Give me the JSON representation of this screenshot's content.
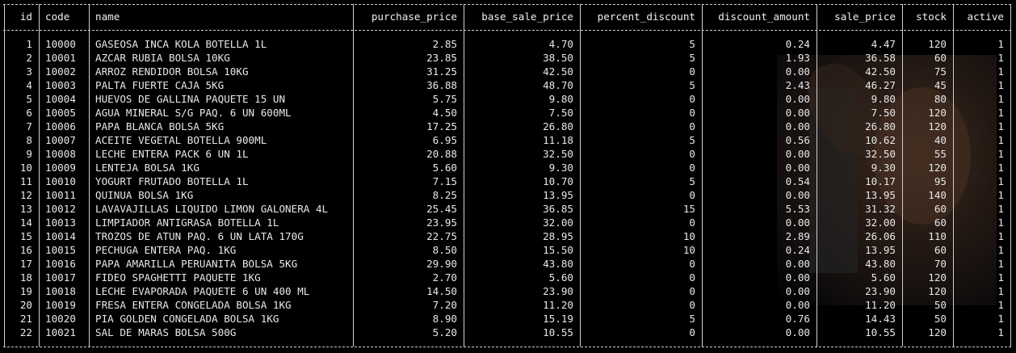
{
  "table": {
    "columns": [
      {
        "key": "id",
        "label": "id",
        "align": "r"
      },
      {
        "key": "code",
        "label": "code",
        "align": "l"
      },
      {
        "key": "name",
        "label": "name",
        "align": "l"
      },
      {
        "key": "purchase_price",
        "label": "purchase_price",
        "align": "r"
      },
      {
        "key": "base_sale_price",
        "label": "base_sale_price",
        "align": "r"
      },
      {
        "key": "percent_discount",
        "label": "percent_discount",
        "align": "r"
      },
      {
        "key": "discount_amount",
        "label": "discount_amount",
        "align": "r"
      },
      {
        "key": "sale_price",
        "label": "sale_price",
        "align": "r"
      },
      {
        "key": "stock",
        "label": "stock",
        "align": "r"
      },
      {
        "key": "active",
        "label": "active",
        "align": "r"
      }
    ],
    "rows": [
      [
        "1",
        "10000",
        "GASEOSA INCA KOLA BOTELLA 1L",
        "2.85",
        "4.70",
        "5",
        "0.24",
        "4.47",
        "120",
        "1"
      ],
      [
        "2",
        "10001",
        "AZCAR RUBIA BOLSA 10KG",
        "23.85",
        "38.50",
        "5",
        "1.93",
        "36.58",
        "60",
        "1"
      ],
      [
        "3",
        "10002",
        "ARROZ RENDIDOR BOLSA 10KG",
        "31.25",
        "42.50",
        "0",
        "0.00",
        "42.50",
        "75",
        "1"
      ],
      [
        "4",
        "10003",
        "PALTA FUERTE CAJA 5KG",
        "36.88",
        "48.70",
        "5",
        "2.43",
        "46.27",
        "45",
        "1"
      ],
      [
        "5",
        "10004",
        "HUEVOS DE GALLINA PAQUETE 15 UN",
        "5.75",
        "9.80",
        "0",
        "0.00",
        "9.80",
        "80",
        "1"
      ],
      [
        "6",
        "10005",
        "AGUA MINERAL S/G PAQ. 6 UN 600ML",
        "4.50",
        "7.50",
        "0",
        "0.00",
        "7.50",
        "120",
        "1"
      ],
      [
        "7",
        "10006",
        "PAPA BLANCA BOLSA 5KG",
        "17.25",
        "26.80",
        "0",
        "0.00",
        "26.80",
        "120",
        "1"
      ],
      [
        "8",
        "10007",
        "ACEITE VEGETAL BOTELLA 900ML",
        "6.95",
        "11.18",
        "5",
        "0.56",
        "10.62",
        "40",
        "1"
      ],
      [
        "9",
        "10008",
        "LECHE ENTERA PACK 6 UN 1L",
        "20.88",
        "32.50",
        "0",
        "0.00",
        "32.50",
        "55",
        "1"
      ],
      [
        "10",
        "10009",
        "LENTEJA BOLSA 1KG",
        "5.60",
        "9.30",
        "0",
        "0.00",
        "9.30",
        "120",
        "1"
      ],
      [
        "11",
        "10010",
        "YOGURT FRUTADO BOTELLA 1L",
        "7.15",
        "10.70",
        "5",
        "0.54",
        "10.17",
        "95",
        "1"
      ],
      [
        "12",
        "10011",
        "QUINUA BOLSA 1KG",
        "8.25",
        "13.95",
        "0",
        "0.00",
        "13.95",
        "140",
        "1"
      ],
      [
        "13",
        "10012",
        "LAVAVAJILLAS LIQUIDO LIMON GALONERA 4L",
        "25.45",
        "36.85",
        "15",
        "5.53",
        "31.32",
        "60",
        "1"
      ],
      [
        "14",
        "10013",
        "LIMPIADOR ANTIGRASA BOTELLA 1L",
        "23.95",
        "32.00",
        "0",
        "0.00",
        "32.00",
        "60",
        "1"
      ],
      [
        "15",
        "10014",
        "TROZOS DE ATUN PAQ. 6 UN LATA 170G",
        "22.75",
        "28.95",
        "10",
        "2.89",
        "26.06",
        "110",
        "1"
      ],
      [
        "16",
        "10015",
        "PECHUGA ENTERA PAQ. 1KG",
        "8.50",
        "15.50",
        "10",
        "0.24",
        "13.95",
        "60",
        "1"
      ],
      [
        "17",
        "10016",
        "PAPA AMARILLA PERUANITA BOLSA 5KG",
        "29.90",
        "43.80",
        "0",
        "0.00",
        "43.80",
        "70",
        "1"
      ],
      [
        "18",
        "10017",
        "FIDEO SPAGHETTI PAQUETE 1KG",
        "2.70",
        "5.60",
        "0",
        "0.00",
        "5.60",
        "120",
        "1"
      ],
      [
        "19",
        "10018",
        "LECHE EVAPORADA PAQUETE 6 UN 400 ML",
        "14.50",
        "23.90",
        "0",
        "0.00",
        "23.90",
        "120",
        "1"
      ],
      [
        "20",
        "10019",
        "FRESA ENTERA CONGELADA BOLSA 1KG",
        "7.20",
        "11.20",
        "0",
        "0.00",
        "11.20",
        "50",
        "1"
      ],
      [
        "21",
        "10020",
        "PIA GOLDEN CONGELADA BOLSA 1KG",
        "8.90",
        "15.19",
        "5",
        "0.76",
        "14.43",
        "50",
        "1"
      ],
      [
        "22",
        "10021",
        "SAL DE MARAS BOLSA 500G",
        "5.20",
        "10.55",
        "0",
        "0.00",
        "10.55",
        "120",
        "1"
      ]
    ]
  },
  "colors": {
    "background": "#000000",
    "text": "#e8e8e8",
    "border": "#cfcfcf"
  }
}
